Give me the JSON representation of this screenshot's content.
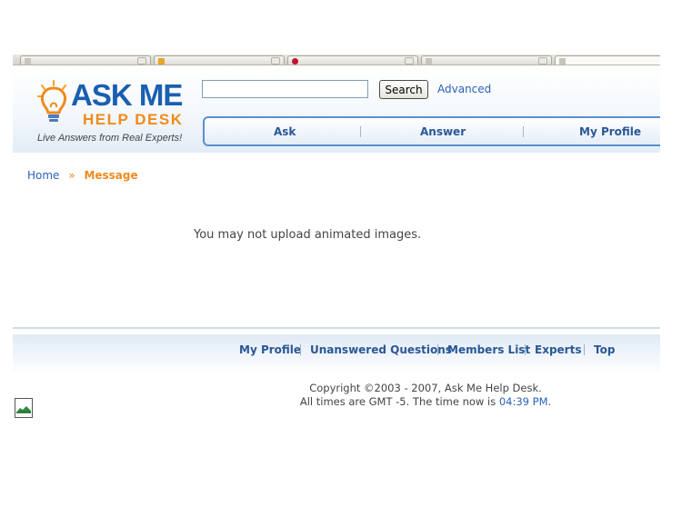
{
  "logo": {
    "ask_me": "ASK ME",
    "help_desk": "HELP DESK",
    "tagline": "Live Answers from Real Experts!"
  },
  "search": {
    "value": "",
    "button_label": "Search",
    "advanced_label": "Advanced"
  },
  "nav": {
    "items": [
      "Ask",
      "Answer",
      "My Profile"
    ]
  },
  "breadcrumb": {
    "home": "Home",
    "separator": "»",
    "current": "Message"
  },
  "message": {
    "text": "You may not upload animated images."
  },
  "footer": {
    "links": [
      "My Profile",
      "Unanswered Questions",
      "Members List",
      "Experts",
      "Top"
    ],
    "copyright": "Copyright ©2003 - 2007, Ask Me Help Desk.",
    "time_prefix": "All times are GMT -5. The time now is",
    "time_value": "04:39 PM",
    "time_suffix": "."
  },
  "colors": {
    "brand_blue": "#1a5fb0",
    "brand_orange": "#f08a1c",
    "link_blue": "#2a62b8"
  }
}
